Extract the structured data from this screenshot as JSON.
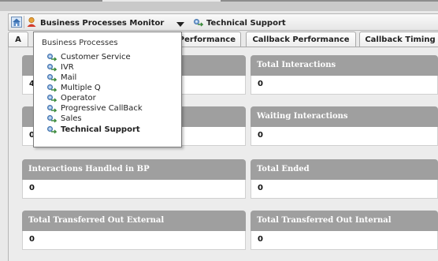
{
  "breadcrumb": {
    "current": "Business Processes Monitor",
    "next": "Technical Support"
  },
  "tabs": [
    {
      "label": "A"
    },
    {
      "label": "Performance"
    },
    {
      "label": "Callback Performance"
    },
    {
      "label": "Callback Timing"
    }
  ],
  "dropdown": {
    "title": "Business Processes",
    "items": [
      {
        "label": "Customer Service"
      },
      {
        "label": "IVR"
      },
      {
        "label": "Mail"
      },
      {
        "label": "Multiple Q"
      },
      {
        "label": "Operator"
      },
      {
        "label": "Progressive CallBack"
      },
      {
        "label": "Sales"
      },
      {
        "label": "Technical Support",
        "selected": true
      }
    ]
  },
  "cards": {
    "left1_value": "4/",
    "left2_value": "0",
    "left3_title": "Interactions Handled in BP",
    "left3_value": "0",
    "left4_title": "Total Transferred Out External",
    "left4_value": "0",
    "right1_title": "Total Interactions",
    "right1_value": "0",
    "right2_title": "Waiting Interactions",
    "right2_value": "0",
    "right3_title": "Total Ended",
    "right3_value": "0",
    "right4_title": "Total Transferred Out Internal",
    "right4_value": "0"
  },
  "colors": {
    "card_header": "#9f9f9f",
    "popup_border": "#7d7d7d"
  }
}
